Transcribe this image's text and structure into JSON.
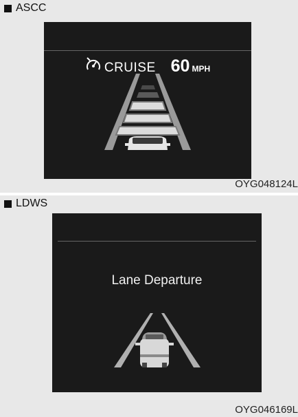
{
  "ascc": {
    "heading": "ASCC",
    "status_label": "CRUISE",
    "speed_value": "60",
    "speed_unit": "MPH",
    "figure_code": "OYG048124L",
    "icon": "cruise-speedometer-icon"
  },
  "ldws": {
    "heading": "LDWS",
    "message": "Lane Departure",
    "figure_code": "OYG046169L"
  },
  "colors": {
    "screen_bg": "#1a1a1a",
    "panel_bg": "#e8e8e8",
    "text_light": "#ffffff"
  }
}
